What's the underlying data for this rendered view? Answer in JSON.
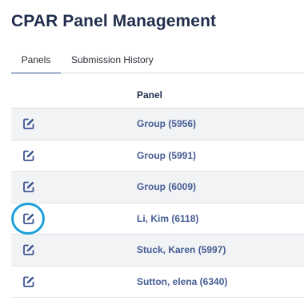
{
  "page": {
    "title": "CPAR Panel Management"
  },
  "tabs": [
    {
      "label": "Panels",
      "active": true
    },
    {
      "label": "Submission History",
      "active": false
    }
  ],
  "table": {
    "header": {
      "panel": "Panel"
    },
    "rows": [
      {
        "panel": "Group (5956)",
        "icon": "edit-icon"
      },
      {
        "panel": "Group (5991)",
        "icon": "edit-icon"
      },
      {
        "panel": "Group (6009)",
        "icon": "edit-icon"
      },
      {
        "panel": "Li, Kim (6118)",
        "icon": "edit-icon"
      },
      {
        "panel": "Stuck, Karen (5997)",
        "icon": "edit-icon"
      },
      {
        "panel": "Sutton, elena (6340)",
        "icon": "edit-icon"
      }
    ]
  },
  "colors": {
    "title": "#1f2d4b",
    "link": "#445c94",
    "icon": "#3b5590",
    "highlight_ring": "#1aa0d8",
    "row_shade": "#f2f3f5"
  }
}
